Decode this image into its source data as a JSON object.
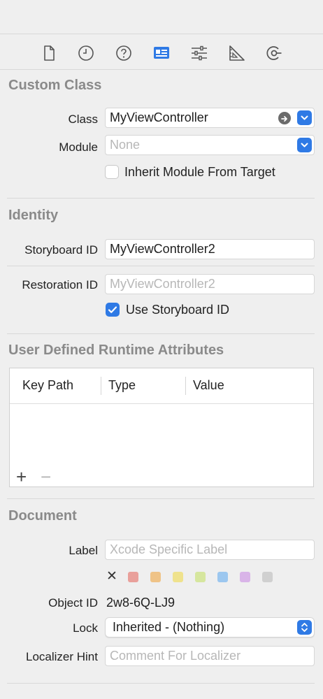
{
  "toolbar": {
    "icons": [
      "file-inspector-icon",
      "history-inspector-icon",
      "quick-help-icon",
      "identity-inspector-icon",
      "attributes-inspector-icon",
      "size-inspector-icon",
      "connections-inspector-icon"
    ],
    "active": "identity-inspector-icon",
    "accent": "#2f7ae5"
  },
  "custom_class": {
    "title": "Custom Class",
    "class_label": "Class",
    "class_value": "MyViewController",
    "module_label": "Module",
    "module_placeholder": "None",
    "inherit_label": "Inherit Module From Target",
    "inherit_checked": false
  },
  "identity": {
    "title": "Identity",
    "storyboard_id_label": "Storyboard ID",
    "storyboard_id_value": "MyViewController2",
    "restoration_id_label": "Restoration ID",
    "restoration_id_placeholder": "MyViewController2",
    "use_storyboard_label": "Use Storyboard ID",
    "use_storyboard_checked": true
  },
  "runtime_attributes": {
    "title": "User Defined Runtime Attributes",
    "columns": [
      "Key Path",
      "Type",
      "Value"
    ],
    "rows": [],
    "add_label": "+",
    "remove_label": "−"
  },
  "document": {
    "title": "Document",
    "label_label": "Label",
    "label_placeholder": "Xcode Specific Label",
    "clear_color": "✕",
    "color_swatches": [
      "#e9a09b",
      "#efc387",
      "#efe28d",
      "#d6e69e",
      "#9cc7ef",
      "#d9b4e8",
      "#d0d0d0"
    ],
    "object_id_label": "Object ID",
    "object_id_value": "2w8-6Q-LJ9",
    "lock_label": "Lock",
    "lock_value": "Inherited - (Nothing)",
    "localizer_label": "Localizer Hint",
    "localizer_placeholder": "Comment For Localizer"
  }
}
